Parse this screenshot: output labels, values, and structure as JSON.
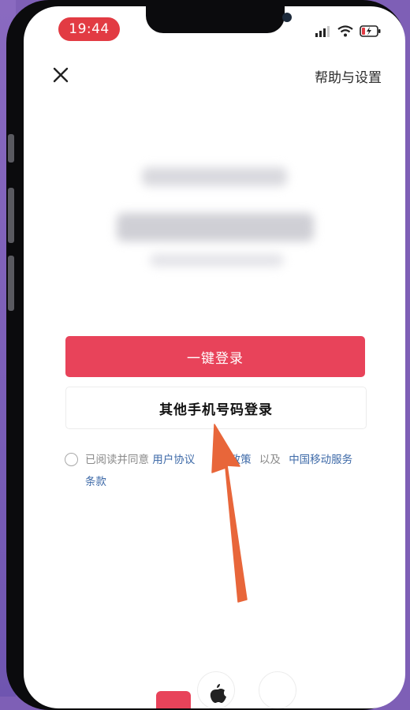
{
  "status_bar": {
    "time": "19:44"
  },
  "header": {
    "close_icon": "close-icon",
    "help_label": "帮助与设置"
  },
  "login": {
    "one_click_label": "一键登录",
    "other_phone_label": "其他手机号码登录"
  },
  "agreement": {
    "prefix": "已阅读并同意",
    "user_agreement": "用户协议",
    "privacy_policy": "政策",
    "and": "以及",
    "carrier_terms": "中国移动服务条款"
  },
  "colors": {
    "primary": "#e8435a",
    "time_pill": "#e23b43",
    "link": "#3e6aa8",
    "arrow": "#e8663a"
  }
}
